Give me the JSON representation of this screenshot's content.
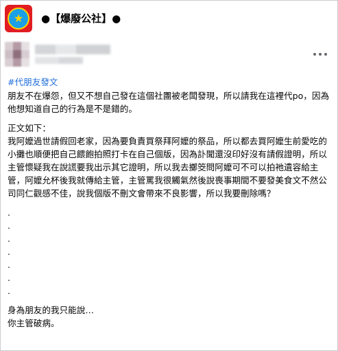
{
  "group": {
    "name": "●【爆廢公社】●"
  },
  "post": {
    "hashtag": "#代朋友發文",
    "intro": "朋友不在爆怨，但又不想自己發在這個社團被老闆發現，所以請我在這裡代po，因為他想知道自己的行為是不是錯的。",
    "body_heading": "正文如下：",
    "body": "我阿嬤過世請假回老家，因為要負責買祭拜阿嬤的祭品，所以都去買阿嬤生前愛吃的小攤也順便把自己餵飽拍照打卡在自己個版，因為訃聞還沒印好沒有請假證明，所以主管懷疑我在說謊要我出示其它證明，所以我去擲筊問阿嬤可不可以拍祂遺容給主管，阿嬤允杯後我就傳給主管，主管罵我很觸氣然後說喪事期間不要發美食文不然公司同仁觀感不佳，說我個版不刪文會帶來不良影響，所以我要刪除嗎？",
    "dots": [
      ".",
      ".",
      ".",
      ".",
      ".",
      ".",
      "."
    ],
    "closing": [
      "身為朋友的我只能說…",
      "你主管破病。"
    ]
  }
}
